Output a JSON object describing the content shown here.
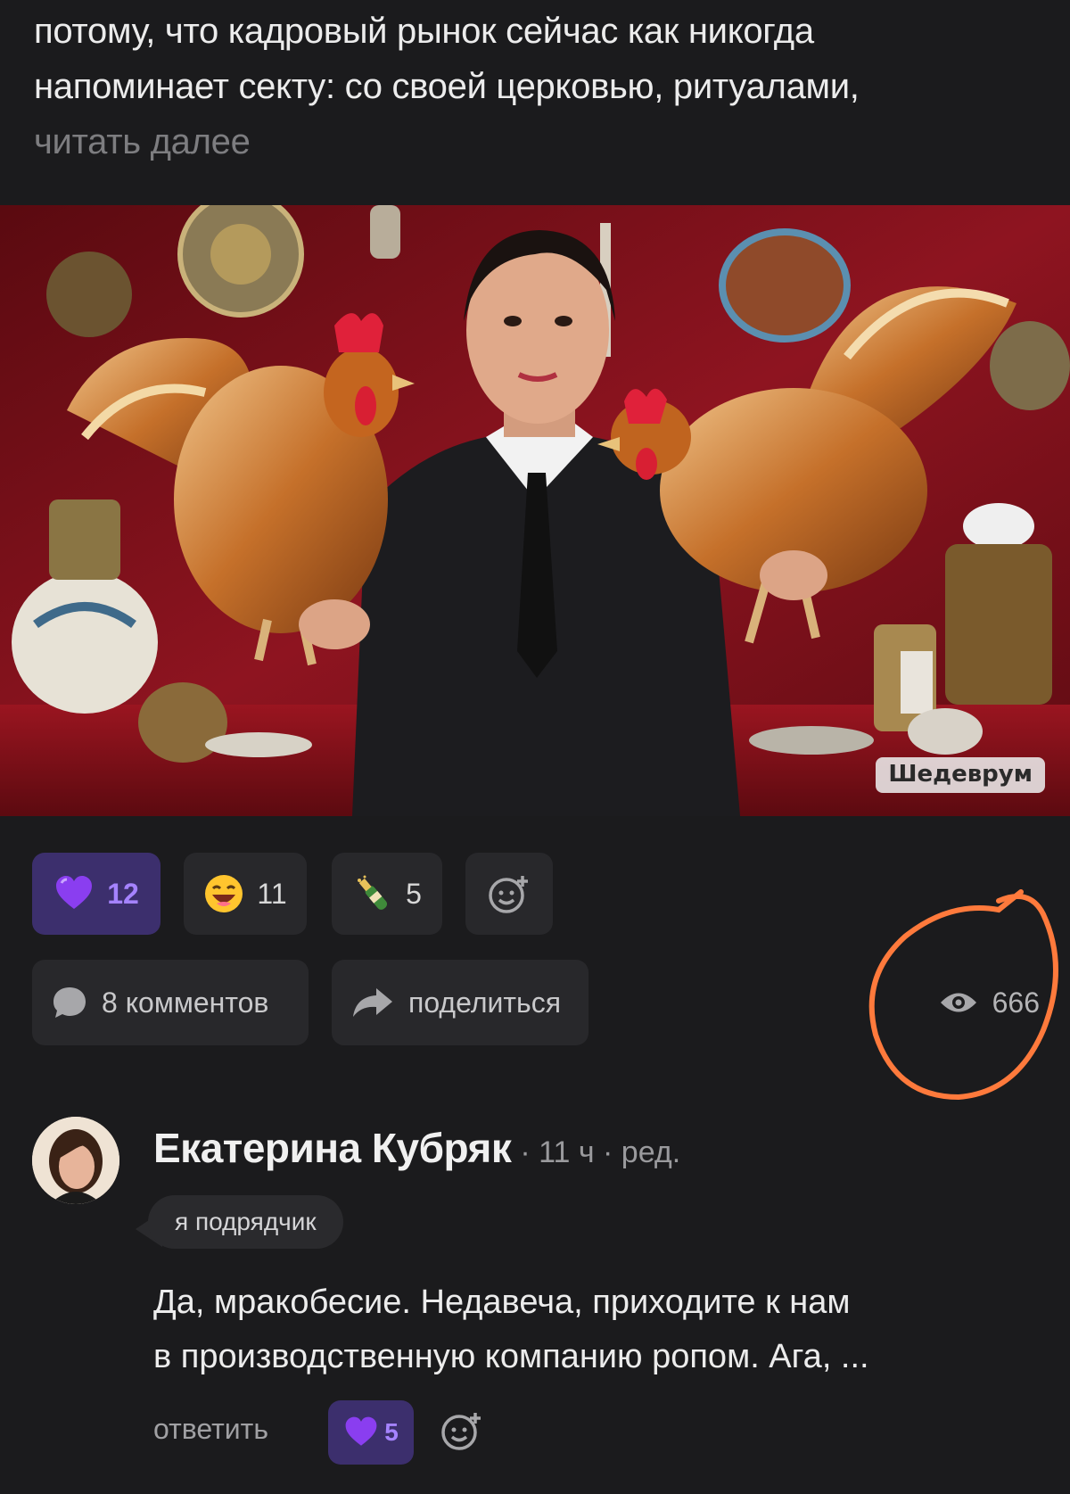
{
  "post": {
    "excerpt_lines": [
      "потому, что кадровый рынок сейчас как никогда",
      "напоминает секту: со своей церковью, ритуалами,"
    ],
    "read_more": "читать далее",
    "image": {
      "watermark": "Шедеврум"
    },
    "reactions": [
      {
        "icon": "purple-heart-icon",
        "count": "12",
        "active": true
      },
      {
        "icon": "laughing-emoji-icon",
        "count": "11",
        "active": false
      },
      {
        "icon": "champagne-bottle-icon",
        "count": "5",
        "active": false
      },
      {
        "icon": "add-reaction-icon",
        "count": "",
        "active": false
      }
    ],
    "comments_label": "8 комментов",
    "share_label": "поделиться",
    "views": "666",
    "annotation_color": "#ff7a3c"
  },
  "comment": {
    "author": "Екатерина Кубряк",
    "meta": "· 11 ч · ред.",
    "tag": "я подрядчик",
    "text_lines": [
      "Да, мракобесие. Недавеча, приходите к нам",
      "в производственную компанию ропом. Ага, ..."
    ],
    "reply_label": "ответить",
    "like_count": "5"
  },
  "colors": {
    "background": "#1b1b1d",
    "chip": "#28282b",
    "accent": "#a583ff",
    "accent_bg": "#3c2f6d"
  }
}
